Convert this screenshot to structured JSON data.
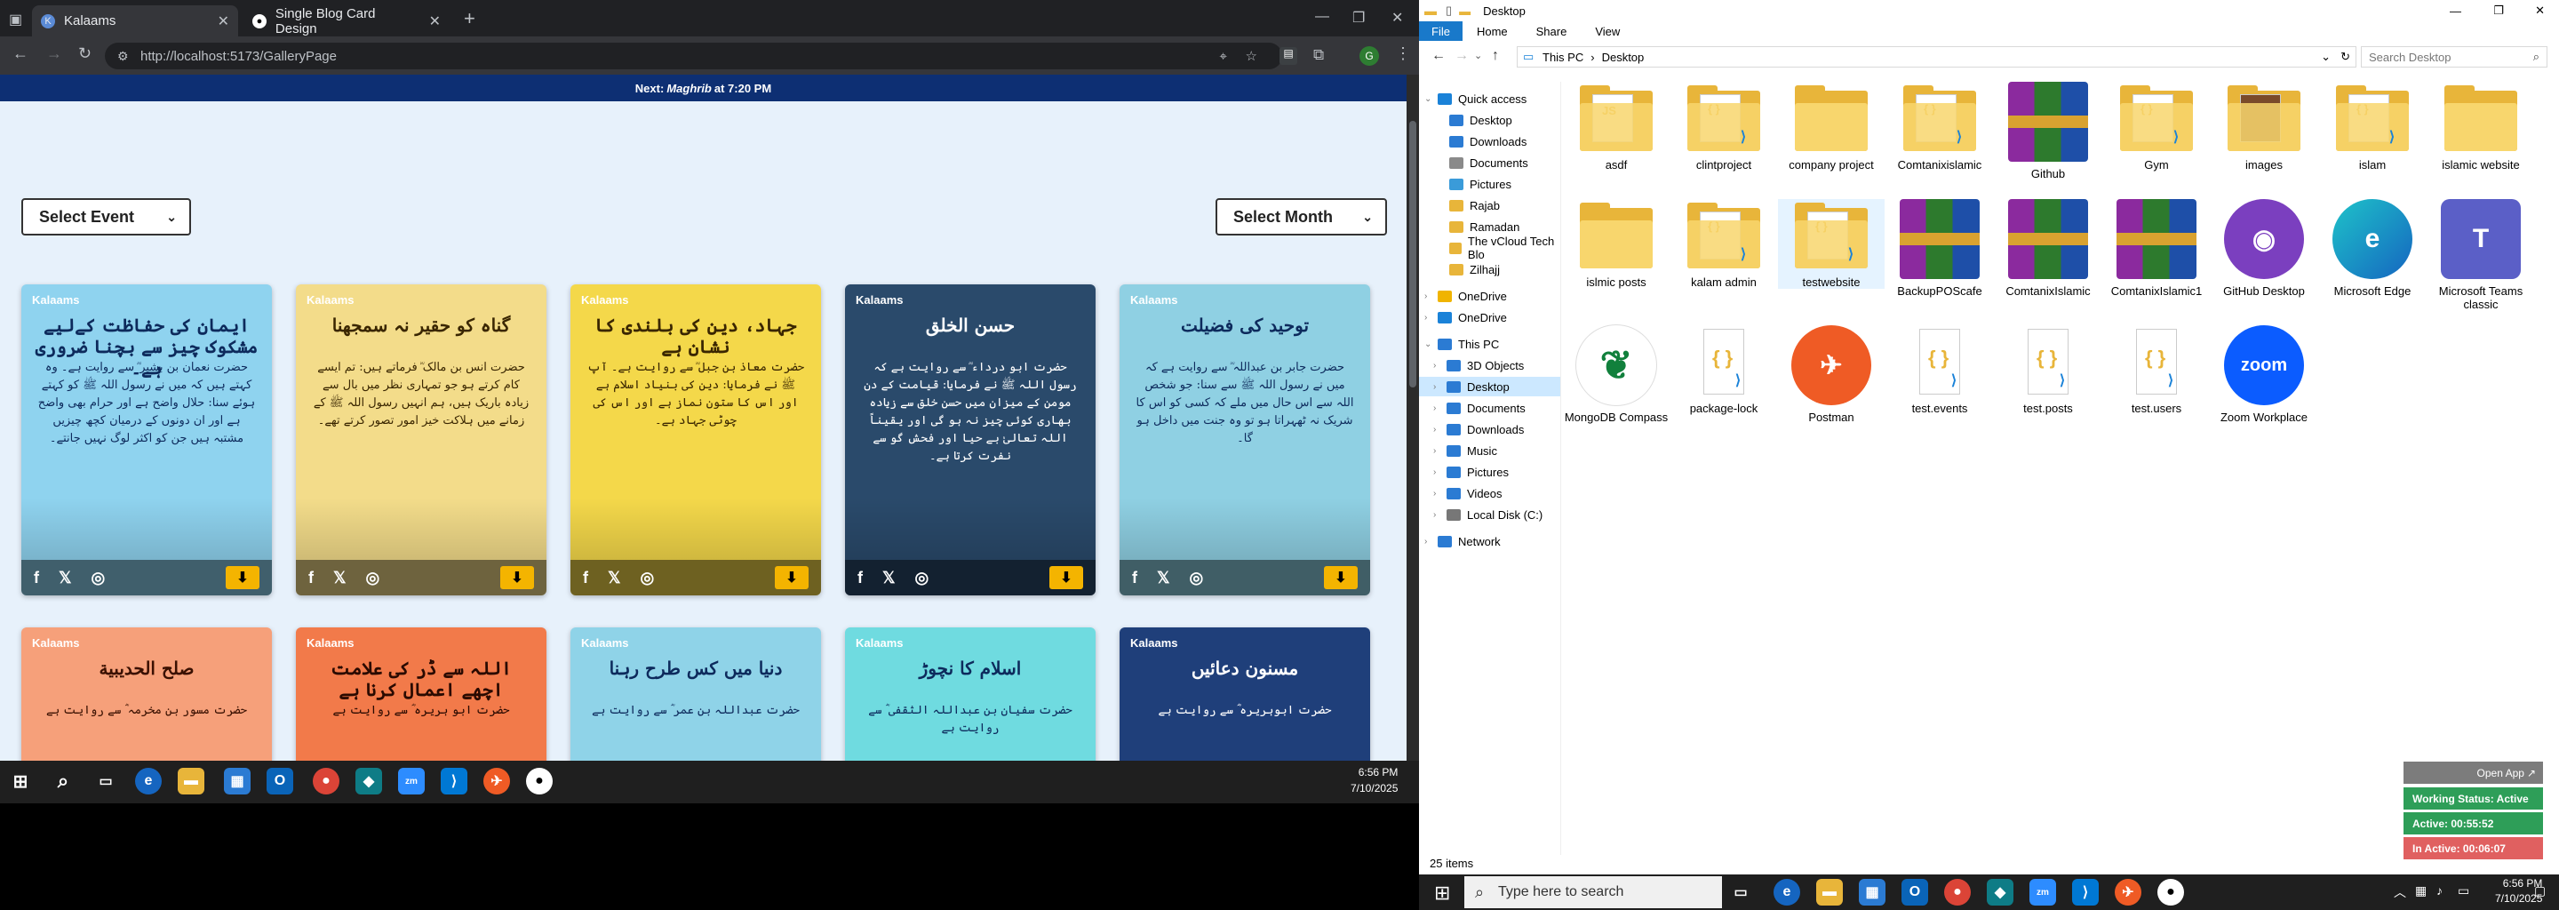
{
  "browser": {
    "tabs": [
      {
        "label": "Kalaams",
        "active": true
      },
      {
        "label": "Single Blog Card Design",
        "active": false
      }
    ],
    "new_tab_label": "+",
    "url": "http://localhost:5173/GalleryPage",
    "profile_initial": "G"
  },
  "page": {
    "prayer_banner_prefix": "Next: ",
    "prayer_banner_bold": "Maghrib",
    "prayer_banner_suffix": " at 7:20 PM",
    "select_event": "Select Event",
    "select_month": "Select Month",
    "brand": "Kalaams",
    "cards": [
      {
        "title": "ایمان کی حفاظت کےلیے مشکوک چیز سے بچنا ضروری ہے۔",
        "body": "حضرت نعمان بن بشیر ؓ سے روایت ہے۔ وہ کہتے ہیں کہ میں نے رسول اللہ ﷺ کو کہتے ہوئے سنا: حلال واضح ہے اور حرام بھی واضح ہے اور ان دونوں کے درمیان کچھ چیزیں مشتبہ ہیں جن کو اکثر لوگ نہیں جانتے۔",
        "bg": "#8fd3ef",
        "fg": "#0d2a5c"
      },
      {
        "title": "گناہ کو حقیر نہ سمجھنا",
        "body": "حضرت انس بن مالک ؓ فرماتے ہیں: تم ایسے کام کرتے ہو جو تمہاری نظر میں بال سے زیادہ باریک ہیں، ہم انہیں رسول اللہ ﷺ کے زمانے میں ہلاکت خیز امور تصور کرتے تھے۔",
        "bg": "#f3dc8a",
        "fg": "#3a2600"
      },
      {
        "title": "جہاد، دین کی بلندی کا نشان ہے",
        "body": "حضرت معاذ بن جبل ؓ سے روایت ہے۔ آپ ﷺ نے فرمایا: دین کی بنیاد اسلام ہے اور اس کا ستون نماز ہے اور اس کی چوٹی جہاد ہے۔",
        "bg": "#f4d84a",
        "fg": "#3a2600"
      },
      {
        "title": "حسن الخلق",
        "body": "حضرت ابو درداء ؓ سے روایت ہے کہ رسول اللہ ﷺ نے فرمایا: قیامت کے دن مومن کے میزان میں حسن خلق سے زیادہ بھاری کوئی چیز نہ ہو گی اور یقیناً اللہ تعالیٰ بے حیا اور فحش گو سے نفرت کرتا ہے۔",
        "bg": "#2a4a6b",
        "fg": "#ffffff"
      },
      {
        "title": "توحید کی فضیلت",
        "body": "حضرت جابر بن عبداللہ ؓ سے روایت ہے کہ میں نے رسول اللہ ﷺ سے سنا: جو شخص اللہ سے اس حال میں ملے کہ کسی کو اس کا شریک نہ ٹھہراتا ہو تو وہ جنت میں داخل ہو گا۔",
        "bg": "#8fd0e3",
        "fg": "#0d2a5c"
      },
      {
        "title": "صلح الحدیبیة",
        "body": "حضرت مسور بن مخرمہ ؓ سے روایت ہے",
        "bg": "#f6a07a",
        "fg": "#3a1000"
      },
      {
        "title": "اللہ سے ڈر کی علامت اچھے اعمال کرنا ہے",
        "body": "حضرت ابو ہریرہ ؓ سے روایت ہے",
        "bg": "#f27a4a",
        "fg": "#2a0a00"
      },
      {
        "title": "دنیا میں کس طرح رہنا",
        "body": "حضرت عبداللہ بن عمر ؓ سے روایت ہے",
        "bg": "#8fd3e8",
        "fg": "#0d2a5c"
      },
      {
        "title": "اسلام کا نچوڑ",
        "body": "حضرت سفیان بن عبداللہ الثقفی ؓ سے روایت ہے",
        "bg": "#6fdbe0",
        "fg": "#0d2a5c"
      },
      {
        "title": "مسنون دعائیں",
        "body": "حضرت ابوہریرہ ؓ سے روایت ہے",
        "bg": "#1f3f7a",
        "fg": "#ffffff"
      }
    ]
  },
  "left_taskbar": {
    "time": "6:56 PM",
    "date": "7/10/2025"
  },
  "explorer": {
    "window_title": "Desktop",
    "ribbon": [
      "File",
      "Home",
      "Share",
      "View"
    ],
    "breadcrumb": [
      "This PC",
      "Desktop"
    ],
    "search_placeholder": "Search Desktop",
    "quick_access_label": "Quick access",
    "quick_access": [
      {
        "label": "Desktop",
        "pinned": true
      },
      {
        "label": "Downloads",
        "pinned": true
      },
      {
        "label": "Documents",
        "pinned": true
      },
      {
        "label": "Pictures",
        "pinned": true
      },
      {
        "label": "Rajab",
        "pinned": false
      },
      {
        "label": "Ramadan",
        "pinned": false
      },
      {
        "label": "The vCloud Tech Blo",
        "pinned": false
      },
      {
        "label": "Zilhajj",
        "pinned": false
      }
    ],
    "onedrive": [
      "OneDrive",
      "OneDrive"
    ],
    "this_pc_label": "This PC",
    "this_pc": [
      "3D Objects",
      "Desktop",
      "Documents",
      "Downloads",
      "Music",
      "Pictures",
      "Videos",
      "Local Disk (C:)"
    ],
    "network_label": "Network",
    "items": [
      {
        "label": "asdf",
        "kind": "folder-js"
      },
      {
        "label": "clintproject",
        "kind": "folder-vscode"
      },
      {
        "label": "company project",
        "kind": "folder"
      },
      {
        "label": "Comtanixislamic",
        "kind": "folder-vscode"
      },
      {
        "label": "Github",
        "kind": "winrar"
      },
      {
        "label": "Gym",
        "kind": "folder-vscode"
      },
      {
        "label": "images",
        "kind": "folder-img"
      },
      {
        "label": "islam",
        "kind": "folder-vscode"
      },
      {
        "label": "islamic website",
        "kind": "folder"
      },
      {
        "label": "islmic posts",
        "kind": "folder"
      },
      {
        "label": "kalam admin",
        "kind": "folder-vscode"
      },
      {
        "label": "testwebsite",
        "kind": "folder-vscode"
      },
      {
        "label": "BackupPOScafe",
        "kind": "winrar"
      },
      {
        "label": "ComtanixIslamic",
        "kind": "winrar"
      },
      {
        "label": "ComtanixIslamic1",
        "kind": "winrar"
      },
      {
        "label": "GitHub Desktop",
        "kind": "github"
      },
      {
        "label": "Microsoft Edge",
        "kind": "edge"
      },
      {
        "label": "Microsoft Teams classic",
        "kind": "teams"
      },
      {
        "label": "MongoDB Compass",
        "kind": "mongo"
      },
      {
        "label": "package-lock",
        "kind": "json"
      },
      {
        "label": "Postman",
        "kind": "postman"
      },
      {
        "label": "test.events",
        "kind": "json"
      },
      {
        "label": "test.posts",
        "kind": "json"
      },
      {
        "label": "test.users",
        "kind": "json"
      },
      {
        "label": "Zoom Workplace",
        "kind": "zoom"
      }
    ],
    "status_count": "25 items"
  },
  "right_taskbar": {
    "search_placeholder": "Type here to search",
    "time": "6:56 PM",
    "date": "7/10/2025"
  },
  "widget": {
    "open_app": "Open App",
    "working_status": "Working Status: Active",
    "active": "Active: 00:55:52",
    "inactive": "In Active: 00:06:07"
  }
}
